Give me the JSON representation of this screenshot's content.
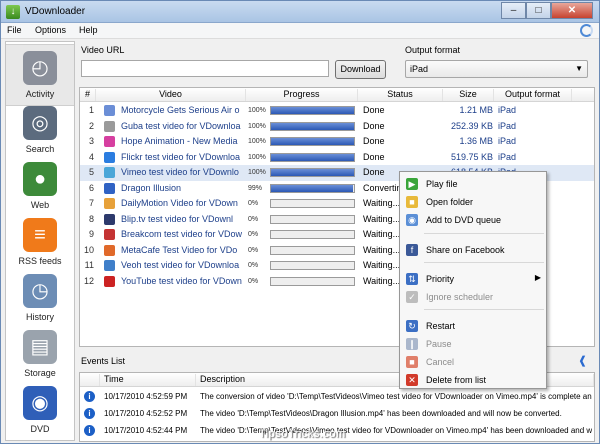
{
  "window": {
    "title": "VDownloader",
    "min": "–",
    "max": "□",
    "close": "✕"
  },
  "menu": [
    "File",
    "Options",
    "Help"
  ],
  "sidebar": [
    {
      "label": "Activity",
      "icon": "speedometer-icon"
    },
    {
      "label": "Search",
      "icon": "binoculars-icon"
    },
    {
      "label": "Web",
      "icon": "globe-icon"
    },
    {
      "label": "RSS feeds",
      "icon": "rss-icon"
    },
    {
      "label": "History",
      "icon": "history-icon"
    },
    {
      "label": "Storage",
      "icon": "storage-icon"
    },
    {
      "label": "DVD",
      "icon": "dvd-icon"
    }
  ],
  "form": {
    "url_label": "Video URL",
    "url_value": "",
    "download_label": "Download",
    "format_label": "Output format",
    "format_value": "iPad"
  },
  "table": {
    "headers": [
      "#",
      "Video",
      "Progress",
      "Status",
      "Size",
      "Output format"
    ],
    "rows": [
      {
        "n": "1",
        "name": "Motorcycle Gets Serious Air o",
        "pct": "100%",
        "progress": 1.0,
        "status": "Done",
        "size": "1.21 MB",
        "format": "iPad",
        "color": "#6b8ed6"
      },
      {
        "n": "2",
        "name": "Guba test video for VDownloa",
        "pct": "100%",
        "progress": 1.0,
        "status": "Done",
        "size": "252.39 KB",
        "format": "iPad",
        "color": "#9a9a9a"
      },
      {
        "n": "3",
        "name": "Hope Animation - New Media",
        "pct": "100%",
        "progress": 1.0,
        "status": "Done",
        "size": "1.36 MB",
        "format": "iPad",
        "color": "#d63fa0"
      },
      {
        "n": "4",
        "name": "Flickr test video for VDownloa",
        "pct": "100%",
        "progress": 1.0,
        "status": "Done",
        "size": "519.75 KB",
        "format": "iPad",
        "color": "#2b7de0"
      },
      {
        "n": "5",
        "name": "Vimeo test video for VDownlo",
        "pct": "100%",
        "progress": 1.0,
        "status": "Done",
        "size": "618.54 KB",
        "format": "iPad",
        "color": "#4aa6d8"
      },
      {
        "n": "6",
        "name": "Dragon Illusion",
        "pct": "99%",
        "progress": 0.99,
        "status": "Convertin",
        "size": "",
        "format": "",
        "color": "#2f62c4"
      },
      {
        "n": "7",
        "name": "DailyMotion Video for VDown",
        "pct": "0%",
        "progress": 0,
        "status": "Waiting...",
        "size": "",
        "format": "",
        "color": "#e7a13a"
      },
      {
        "n": "8",
        "name": "Blip.tv test video for VDownl",
        "pct": "0%",
        "progress": 0,
        "status": "Waiting...",
        "size": "",
        "format": "",
        "color": "#2d3a6c"
      },
      {
        "n": "9",
        "name": "Breakcom test video for VDow",
        "pct": "0%",
        "progress": 0,
        "status": "Waiting...",
        "size": "",
        "format": "",
        "color": "#c43333"
      },
      {
        "n": "10",
        "name": "MetaCafe Test Video for VDo",
        "pct": "0%",
        "progress": 0,
        "status": "Waiting...",
        "size": "",
        "format": "",
        "color": "#e0692a"
      },
      {
        "n": "11",
        "name": "Veoh test video for VDownloa",
        "pct": "0%",
        "progress": 0,
        "status": "Waiting...",
        "size": "",
        "format": "",
        "color": "#3f7fc9"
      },
      {
        "n": "12",
        "name": "YouTube test video for VDown",
        "pct": "0%",
        "progress": 0,
        "status": "Waiting...",
        "size": "",
        "format": "",
        "color": "#cc2222"
      }
    ]
  },
  "context_menu": [
    {
      "label": "Play file",
      "icon": "play-icon",
      "color": "#3aa53a",
      "disabled": false
    },
    {
      "label": "Open folder",
      "icon": "folder-icon",
      "color": "#e8b93a",
      "disabled": false
    },
    {
      "label": "Add to DVD queue",
      "icon": "dvd-add-icon",
      "color": "#5b8fd6",
      "disabled": false
    },
    {
      "label": "Share on Facebook",
      "icon": "facebook-icon",
      "color": "#3b5998",
      "disabled": false
    },
    {
      "label": "Priority",
      "icon": "priority-icon",
      "color": "#3c6fc4",
      "disabled": false,
      "submenu": true
    },
    {
      "label": "Ignore scheduler",
      "icon": "check-icon",
      "color": "#bdbdbd",
      "disabled": true
    },
    {
      "label": "Restart",
      "icon": "restart-icon",
      "color": "#3c6fc4",
      "disabled": false
    },
    {
      "label": "Pause",
      "icon": "pause-icon",
      "color": "#aab7cc",
      "disabled": true
    },
    {
      "label": "Cancel",
      "icon": "cancel-icon",
      "color": "#e07f6a",
      "disabled": true
    },
    {
      "label": "Delete from list",
      "icon": "delete-icon",
      "color": "#d23a2a",
      "disabled": false
    }
  ],
  "events": {
    "title": "Events List",
    "headers": [
      "Time",
      "Description"
    ],
    "rows": [
      {
        "time": "10/17/2010 4:52:59 PM",
        "desc": "The conversion of video 'D:\\Temp\\TestVideos\\Vimeo test video for VDownloader on Vimeo.mp4' is complete and"
      },
      {
        "time": "10/17/2010 4:52:52 PM",
        "desc": "The video 'D:\\Temp\\TestVideos\\Dragon Illusion.mp4' has been downloaded and will now be converted."
      },
      {
        "time": "10/17/2010 4:52:44 PM",
        "desc": "The video 'D:\\Temp\\TestVideos\\Vimeo test video for VDownloader on Vimeo.mp4' has been downloaded and will"
      }
    ]
  },
  "watermark": "TipsoTricks.com"
}
